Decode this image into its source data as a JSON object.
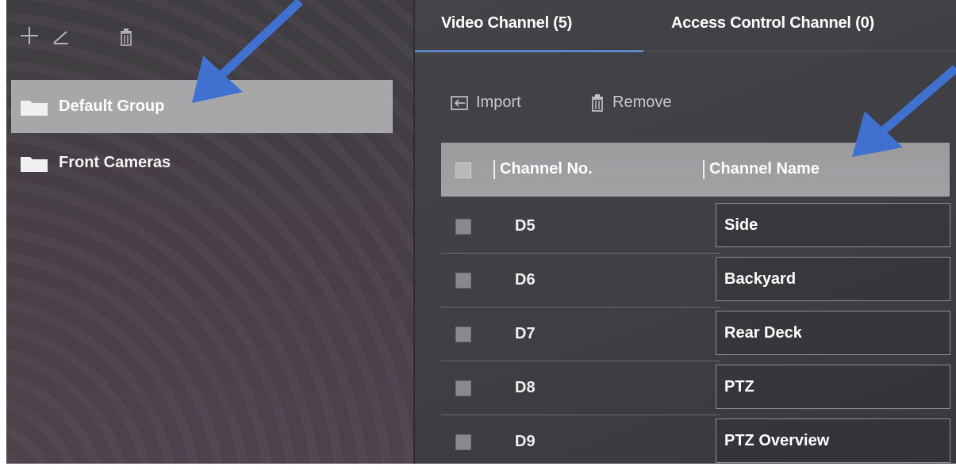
{
  "sidebar": {
    "groups": [
      {
        "label": "Default Group",
        "selected": true
      },
      {
        "label": "Front Cameras",
        "selected": false
      }
    ]
  },
  "tabs": [
    {
      "label": "Video Channel (5)",
      "active": true
    },
    {
      "label": "Access Control Channel (0)",
      "active": false
    }
  ],
  "actions": {
    "import_label": "Import",
    "remove_label": "Remove"
  },
  "table": {
    "columns": [
      "Channel No.",
      "Channel Name"
    ],
    "rows": [
      {
        "channel_no": "D5",
        "channel_name": "Side"
      },
      {
        "channel_no": "D6",
        "channel_name": "Backyard"
      },
      {
        "channel_no": "D7",
        "channel_name": "Rear Deck"
      },
      {
        "channel_no": "D8",
        "channel_name": "PTZ"
      },
      {
        "channel_no": "D9",
        "channel_name": "PTZ Overview"
      }
    ]
  },
  "colors": {
    "accent": "#5b86c2",
    "annotation_arrow": "#3f72d0",
    "selected_row": "#a7a6a8"
  },
  "icons": [
    "plus-icon",
    "pencil-icon",
    "trash-icon",
    "folder-icon",
    "import-icon",
    "checkbox-icon",
    "annotation-arrow"
  ]
}
